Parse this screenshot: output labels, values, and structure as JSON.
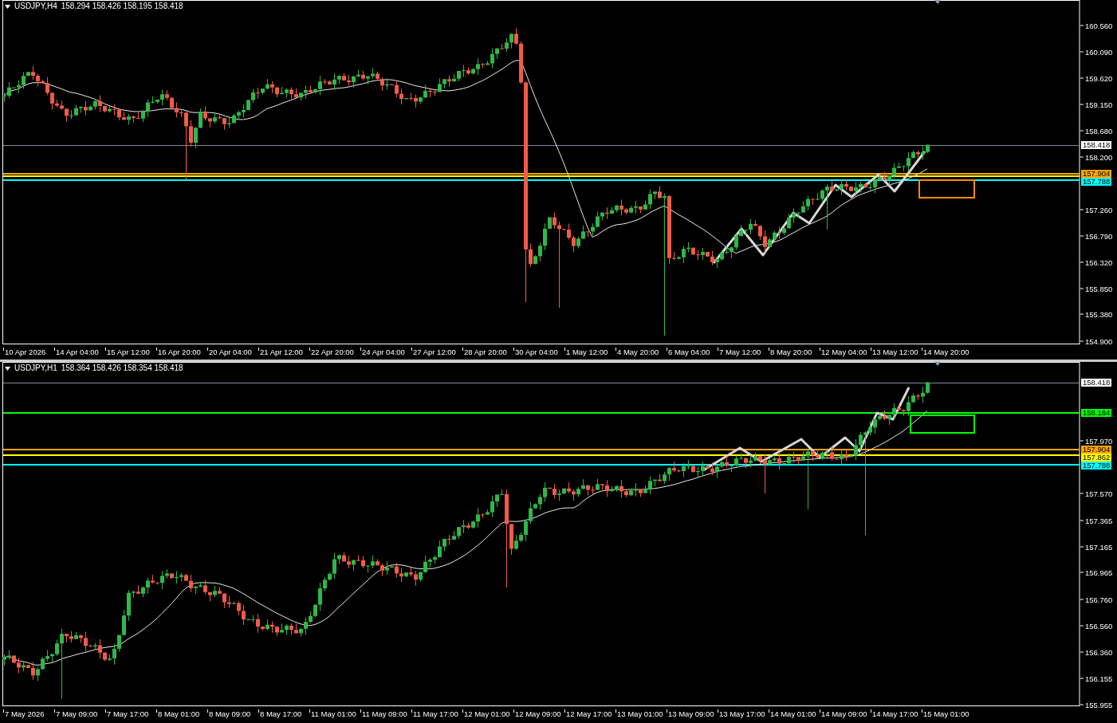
{
  "panes": [
    {
      "header": {
        "symbol": "USDJPY,H4",
        "prices": "158.294 158.426 158.195 158.418"
      },
      "price_axis": [
        "160.560",
        "160.090",
        "159.620",
        "159.150",
        "158.680",
        "158.200",
        "157.260",
        "156.790",
        "156.320",
        "155.850",
        "155.380",
        "154.900"
      ],
      "levels": [
        {
          "kind": "bid",
          "label": "158.418",
          "color": "#ffffff"
        },
        {
          "kind": "level",
          "label": "157.904",
          "color": "#ffa500"
        },
        {
          "kind": "line",
          "color": "#ffff00"
        },
        {
          "kind": "level",
          "label": "157.788",
          "color": "#00ffff"
        }
      ],
      "zone": {
        "color": "#ff8c00"
      },
      "time_axis": [
        "10 Apr 2026",
        "14 Apr 04:00",
        "15 Apr 12:00",
        "16 Apr 20:00",
        "20 Apr 04:00",
        "21 Apr 12:00",
        "22 Apr 20:00",
        "24 Apr 04:00",
        "27 Apr 12:00",
        "28 Apr 20:00",
        "30 Apr 04:00",
        "1 May 12:00",
        "4 May 20:00",
        "6 May 04:00",
        "7 May 12:00",
        "8 May 20:00",
        "12 May 04:00",
        "13 May 12:00",
        "14 May 20:00"
      ]
    },
    {
      "header": {
        "symbol": "USDJPY,H1",
        "prices": "158.364 158.426 158.354 158.418"
      },
      "price_axis": [
        "157.970",
        "157.570",
        "157.365",
        "157.165",
        "156.965",
        "156.760",
        "156.560",
        "156.360",
        "156.155",
        "155.955"
      ],
      "levels": [
        {
          "kind": "bid",
          "label": "158.418",
          "color": "#ffffff"
        },
        {
          "kind": "level",
          "label": "158.184",
          "color": "#00ff00"
        },
        {
          "kind": "level",
          "label": "157.904",
          "color": "#ffa500"
        },
        {
          "kind": "level",
          "label": "157.862",
          "color": "#ffff00"
        },
        {
          "kind": "level",
          "label": "157.788",
          "color": "#00ffff"
        }
      ],
      "zone": {
        "color": "#00ff00"
      },
      "time_axis": [
        "7 May 2026",
        "7 May 09:00",
        "7 May 17:00",
        "8 May 01:00",
        "8 May 09:00",
        "8 May 17:00",
        "11 May 01:00",
        "11 May 09:00",
        "11 May 17:00",
        "12 May 01:00",
        "12 May 09:00",
        "12 May 17:00",
        "13 May 01:00",
        "13 May 09:00",
        "13 May 17:00",
        "14 May 01:00",
        "14 May 09:00",
        "14 May 17:00",
        "15 May 01:00"
      ]
    }
  ]
}
